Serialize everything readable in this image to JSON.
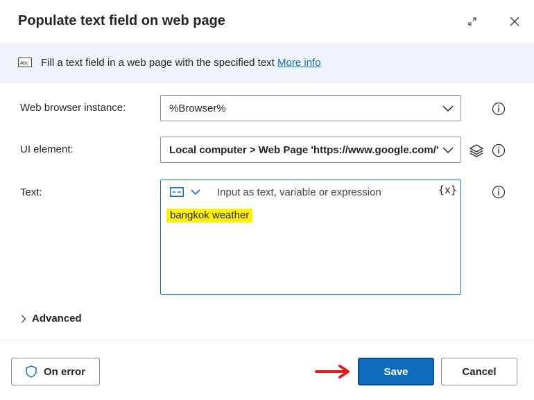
{
  "dialog": {
    "title": "Populate text field on web page",
    "info_text": "Fill a text field in a web page with the specified text",
    "info_link": "More info"
  },
  "fields": {
    "browser": {
      "label": "Web browser instance:",
      "value": "%Browser%"
    },
    "ui_element": {
      "label": "UI element:",
      "value": "Local computer > Web Page 'https://www.google.com/' > "
    },
    "text": {
      "label": "Text:",
      "placeholder": "Input as text, variable or expression",
      "var_button": "{x}",
      "value": "bangkok weather"
    }
  },
  "advanced_label": "Advanced",
  "buttons": {
    "on_error": "On error",
    "save": "Save",
    "cancel": "Cancel"
  },
  "colors": {
    "accent": "#0f6cbd",
    "info_bg": "#eff4fb",
    "highlight": "#fff100",
    "annotation_arrow": "#e02020"
  }
}
